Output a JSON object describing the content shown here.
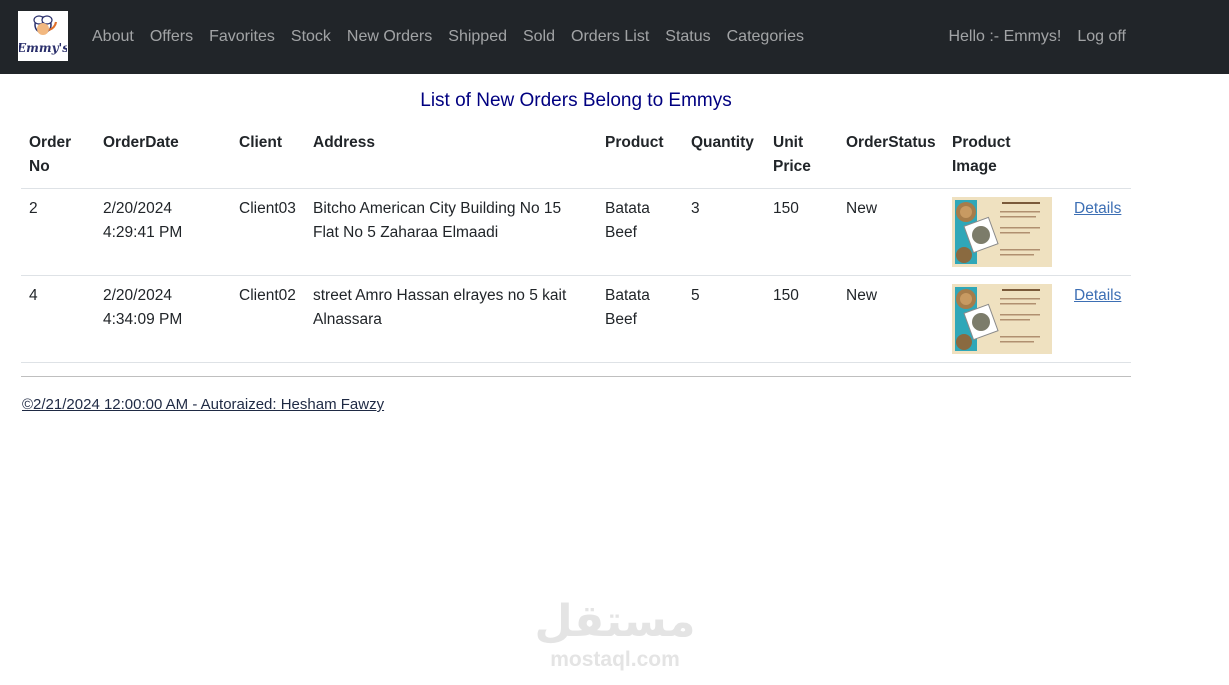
{
  "navbar": {
    "logo_text": "Emmy's",
    "links": [
      "About",
      "Offers",
      "Favorites",
      "Stock",
      "New Orders",
      "Shipped",
      "Sold",
      "Orders List",
      "Status",
      "Categories"
    ],
    "greeting": "Hello :- Emmys!",
    "logoff": "Log off"
  },
  "page_title": "List of New Orders Belong to Emmys",
  "table": {
    "headers": [
      "Order No",
      "OrderDate",
      "Client",
      "Address",
      "Product",
      "Quantity",
      "Unit Price",
      "OrderStatus",
      "Product Image",
      ""
    ],
    "rows": [
      {
        "order_no": "2",
        "order_date": "2/20/2024 4:29:41 PM",
        "client": "Client03",
        "address": "Bitcho American City Building No 15 Flat No 5 Zaharaa Elmaadi",
        "product": "Batata Beef",
        "quantity": "3",
        "unit_price": "150",
        "status": "New",
        "details": "Details"
      },
      {
        "order_no": "4",
        "order_date": "2/20/2024 4:34:09 PM",
        "client": "Client02",
        "address": "street Amro Hassan elrayes no 5 kait Alnassara",
        "product": "Batata Beef",
        "quantity": "5",
        "unit_price": "150",
        "status": "New",
        "details": "Details"
      }
    ]
  },
  "footer": "©2/21/2024 12:00:00 AM - Autoraized: Hesham Fawzy",
  "watermark": {
    "arabic": "مستقل",
    "latin": "mostaql.com"
  },
  "colors": {
    "navbar_bg": "#212529",
    "title": "#000080",
    "link": "#3d6fb4"
  }
}
